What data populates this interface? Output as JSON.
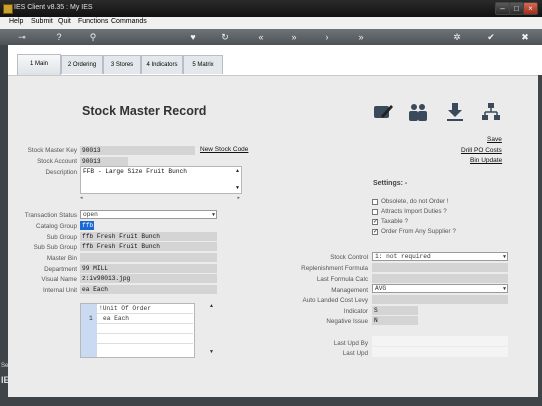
{
  "window": {
    "title": "IES Client v8.35 : My IES"
  },
  "menu": [
    "Help",
    "Submit",
    "Quit",
    "Functions",
    "Commands"
  ],
  "tabs": [
    {
      "label": "1 Main"
    },
    {
      "label": "2 Ordering"
    },
    {
      "label": "3 Stores"
    },
    {
      "label": "4 Indicators"
    },
    {
      "label": "5 Matrix"
    }
  ],
  "page": {
    "title": "Stock Master Record"
  },
  "links": {
    "new_stock_code": "New Stock Code",
    "save": "Save",
    "drill_po": "Drill PO Costs",
    "bin_update": "Bin Update"
  },
  "left_fields": {
    "stock_master_key": {
      "label": "Stock Master Key",
      "value": "90013"
    },
    "stock_account": {
      "label": "Stock Account",
      "value": "90013"
    },
    "description": {
      "label": "Description",
      "value": "FFB - Large Size Fruit Bunch"
    },
    "transaction_status": {
      "label": "Transaction Status",
      "value": "open"
    },
    "catalog_group": {
      "label": "Catalog Group",
      "value": "ffb"
    },
    "sub_group": {
      "label": "Sub Group",
      "value": "ffb Fresh Fruit Bunch"
    },
    "sub_sub_group": {
      "label": "Sub Sub Group",
      "value": "ffb Fresh Fruit Bunch"
    },
    "master_bin": {
      "label": "Master Bin",
      "value": ""
    },
    "department": {
      "label": "Department",
      "value": "99 MILL"
    },
    "visual_name": {
      "label": "Visual Name",
      "value": "z:iv90013.jpg"
    },
    "internal_unit": {
      "label": "Internal Unit",
      "value": "ea Each"
    }
  },
  "unit_table": {
    "header": "!Unit Of Order",
    "rows": [
      {
        "num": "1",
        "value": "ea Each"
      }
    ]
  },
  "settings": {
    "title": "Settings: -",
    "options": [
      {
        "label": "Obsolete, do not Order !",
        "checked": false
      },
      {
        "label": "Attracts Import Duties ?",
        "checked": false
      },
      {
        "label": "Taxable ?",
        "checked": true
      },
      {
        "label": "Order From Any Supplier ?",
        "checked": true
      }
    ]
  },
  "right_fields": {
    "stock_control": {
      "label": "Stock Control",
      "value": "1: not required"
    },
    "replenishment_formula": {
      "label": "Replenishment Formula",
      "value": ""
    },
    "last_formula_calc": {
      "label": "Last Formula Calc",
      "value": ""
    },
    "management": {
      "label": "Management",
      "value": "AVG"
    },
    "auto_landed_cost_levy": {
      "label": "Auto Landed Cost Levy",
      "value": ""
    },
    "indicator": {
      "label": "Indicator",
      "value": "S"
    },
    "negative_issue": {
      "label": "Negative Issue",
      "value": "N"
    },
    "last_upd_by": {
      "label": "Last Upd By",
      "value": ""
    },
    "last_upd": {
      "label": "Last Upd",
      "value": ""
    }
  },
  "side_strip": {
    "top_text": "Ses",
    "bottom_text": "IES"
  },
  "colors": {
    "title_bar": "#111111",
    "toolbar": "#5e6368",
    "panel": "#ebebeb",
    "field": "#d4d4d4",
    "highlight": "#1a6ad6"
  }
}
